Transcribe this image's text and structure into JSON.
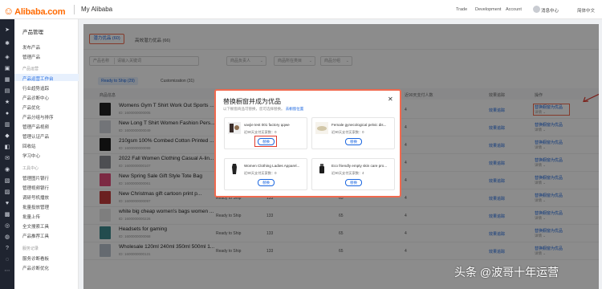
{
  "header": {
    "logo": "Alibaba.com",
    "section": "My Alibaba",
    "links": [
      "Trade",
      "Development",
      "Account"
    ],
    "message_center": "消息中心",
    "language": "简体中文"
  },
  "left_nav": {
    "title": "产品管理",
    "items": [
      {
        "type": "item",
        "label": "发布产品"
      },
      {
        "type": "item",
        "label": "管理产品"
      },
      {
        "type": "group",
        "label": "产品运营"
      },
      {
        "type": "item",
        "label": "产品运营工作台",
        "active": true
      },
      {
        "type": "item",
        "label": "行业趋势追踪"
      },
      {
        "type": "item",
        "label": "产品诊断中心"
      },
      {
        "type": "item",
        "label": "产品优化"
      },
      {
        "type": "item",
        "label": "产品分组与排序"
      },
      {
        "type": "item",
        "label": "管理产品视频"
      },
      {
        "type": "item",
        "label": "管理认证产品"
      },
      {
        "type": "item",
        "label": "回收站"
      },
      {
        "type": "item",
        "label": "学习中心"
      },
      {
        "type": "group",
        "label": "工具中心"
      },
      {
        "type": "item",
        "label": "管理图片银行"
      },
      {
        "type": "item",
        "label": "管理视频银行"
      },
      {
        "type": "item",
        "label": "调研号机播放"
      },
      {
        "type": "item",
        "label": "批量投放管理"
      },
      {
        "type": "item",
        "label": "批量上传"
      },
      {
        "type": "item",
        "label": "全文搜索工具"
      },
      {
        "type": "item",
        "label": "产品推荐工具"
      },
      {
        "type": "group",
        "label": "服务记录"
      },
      {
        "type": "item",
        "label": "服务诊断看板"
      },
      {
        "type": "item",
        "label": "产品诊断优化"
      }
    ]
  },
  "tabs": [
    {
      "label": "潜力优品 (60)",
      "active": true
    },
    {
      "label": "高效潜力优品 (66)",
      "active": false
    }
  ],
  "filters": {
    "product_name_label": "产品名称",
    "product_name_placeholder": "请输入关键词",
    "owner": "商品负责人",
    "category": "商品所在类目",
    "group": "商品分组"
  },
  "sub_tabs": [
    {
      "label": "Ready to Ship (29)",
      "active": true
    },
    {
      "label": "Customization (31)",
      "active": false
    }
  ],
  "table": {
    "headers": [
      "商品信息",
      "近90天支付人数",
      "效果追踪",
      "操作"
    ],
    "rows": [
      {
        "title": "Womens Gym T Shirt Work Out Sports ...",
        "id": "ID: 1600000000005",
        "type": "",
        "c1": "",
        "c2": "",
        "c3": "4",
        "track": "效果追踪",
        "action": "替换橱窗为优品",
        "more": "详情 ⌄",
        "color": "#222"
      },
      {
        "title": "New Long T Shirt Women Fashion Pers...",
        "id": "ID: 1600000000049",
        "type": "",
        "c1": "",
        "c2": "",
        "c3": "4",
        "track": "效果追踪",
        "action": "替换橱窗为优品",
        "more": "详情 ⌄",
        "color": "#cfd3da"
      },
      {
        "title": "210gsm 100% Combed Cotton Printed ...",
        "id": "ID: 1600000000099",
        "type": "",
        "c1": "",
        "c2": "",
        "c3": "4",
        "track": "效果追踪",
        "action": "替换橱窗为优品",
        "more": "详情 ⌄",
        "color": "#1d1d1d"
      },
      {
        "title": "2022 Fall Women Clothing Casual A-lin...",
        "id": "ID: 1600000000107",
        "type": "",
        "c1": "",
        "c2": "",
        "c3": "4",
        "track": "效果追踪",
        "action": "替换橱窗为优品",
        "more": "详情 ⌄",
        "color": "#8c8f96"
      },
      {
        "title": "New Spring Sale Gift Style Tote Bag",
        "id": "ID: 1600000000061",
        "type": "",
        "c1": "",
        "c2": "",
        "c3": "4",
        "track": "效果追踪",
        "action": "替换橱窗为优品",
        "more": "详情 ⌄",
        "color": "#e24b7a"
      },
      {
        "title": "New Christmas gift cartoon print p...",
        "id": "ID: 1600000000097",
        "type": "Ready to Ship",
        "c1": "133",
        "c2": "65",
        "c3": "4",
        "track": "效果追踪",
        "action": "替换橱窗为优品",
        "more": "详情 ⌄",
        "color": "#c43b3b"
      },
      {
        "title": "white big cheap women's bags women ...",
        "id": "ID: 1600000000226",
        "type": "Ready to Ship",
        "c1": "133",
        "c2": "65",
        "c3": "4",
        "track": "效果追踪",
        "action": "替换橱窗为优品",
        "more": "详情 ⌄",
        "color": "#e6e6e6"
      },
      {
        "title": "Headsets for gaming",
        "id": "ID: 1600000000068",
        "type": "Ready to Ship",
        "c1": "133",
        "c2": "65",
        "c3": "4",
        "track": "效果追踪",
        "action": "替换橱窗为优品",
        "more": "详情 ⌄",
        "color": "#3f8a8f"
      },
      {
        "title": "Wholesale 120ml 240ml 350ml 500ml 1...",
        "id": "ID: 1600000000131",
        "type": "Ready to Ship",
        "c1": "133",
        "c2": "65",
        "c3": "4",
        "track": "效果追踪",
        "action": "替换橱窗为优品",
        "more": "详情 ⌄",
        "color": "#b9c2cc"
      }
    ]
  },
  "modal": {
    "title": "替换橱窗并成为优品",
    "desc": "以下橱窗商品可替换，您可选择替换。",
    "desc_link": "去橱窗位置",
    "replace_label": "替换",
    "cards": [
      {
        "title": "vavjie test 001 factory qqwe",
        "info": "近90天支付买家数：",
        "count": "0",
        "color": "#3a2d2a"
      },
      {
        "title": "Female gynecological pelvic dis...",
        "info": "近90天支付买家数：",
        "count": "0",
        "color": "#d2c7a8"
      },
      {
        "title": "Women Clothing Ladies Apparel...",
        "info": "近90天支付买家数：",
        "count": "0",
        "color": "#222222"
      },
      {
        "title": "Eco friendly empty skin care pro...",
        "info": "近90天支付买家数：",
        "count": "4",
        "color": "#1c1c1c"
      }
    ]
  },
  "watermark": "头条 @波哥十年运营"
}
